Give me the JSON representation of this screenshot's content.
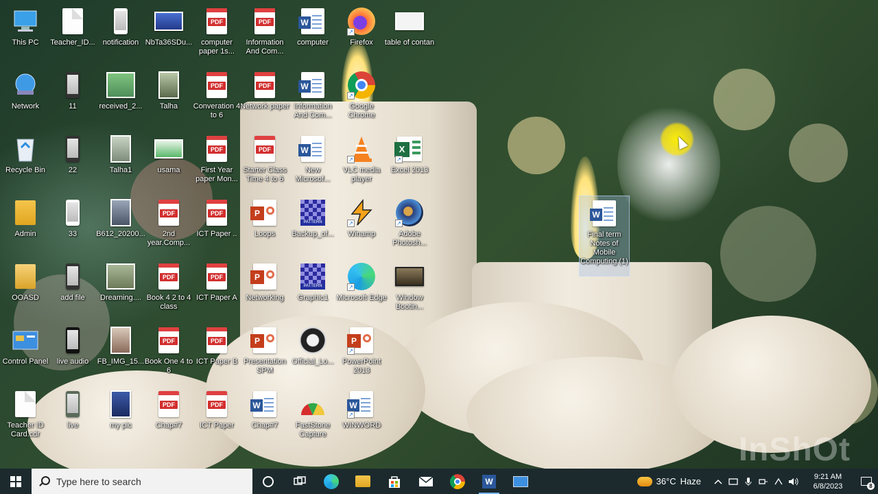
{
  "desktop": {
    "icons": {
      "this_pc": "This PC",
      "teacher_id": "Teacher_ID...",
      "notification": "notification",
      "nbta": "NbTa36SDu...",
      "computer_paper": "computer paper 1s...",
      "information_and_com_1": "Information And Com...",
      "computer": "computer",
      "firefox": "Firefox",
      "table_of_contan": "table of contan",
      "network": "Network",
      "eleven": "11",
      "received": "received_2...",
      "talha": "Talha",
      "converation": "Converation 4 to 6",
      "network_paper": "Network paper",
      "information_and_com_2": "Information And Com...",
      "google_chrome": "Google Chrome",
      "recycle_bin": "Recycle Bin",
      "twentytwo": "22",
      "talha1": "Talha1",
      "usama": "usama",
      "first_year_paper": "First Year paper Mon...",
      "starter_class": "Starter Class Time 4 to 6",
      "new_microsoft": "New Microsof...",
      "vlc": "VLC media player",
      "excel_2013": "Excel 2013",
      "admin": "Admin",
      "thirtythree": "33",
      "b612": "B612_20200...",
      "second_year": "2nd year.Comp...",
      "ict_paper_dots": "ICT Paper ..",
      "loops": "Loops",
      "backup_of": "Backup_of...",
      "winamp": "Winamp",
      "adobe_photoshop": "Adobe Photosh...",
      "final_term": "Final term Notes of Mobile Computing (1)",
      "ooasd": "OOASD",
      "add_file": "add file",
      "dreaming": "Dreaming....",
      "book_4_2": "Book 4 2 to 4 class",
      "ict_paper_a": "ICT Paper A",
      "networking": "Networking",
      "graphic1": "Graphic1",
      "microsoft_edge": "Microsoft Edge",
      "window_booting": "Window Bootin...",
      "control_panel": "Control Panel",
      "live_audio": "live audio",
      "fb_img": "FB_IMG_15...",
      "book_one": "Book One 4 to 6",
      "ict_paper_b": "ICT Paper B",
      "presentation_spm": "Presentation SPM",
      "official_lo": "Official_Lo...",
      "powerpoint_2013": "PowerPoint 2013",
      "teacher_id_card": "Teacher ID Card.cdr",
      "live": "live",
      "my_pic": "my pic",
      "chap7_pdf": "Chap#7",
      "ict_paper": "ICT Paper",
      "chap7_word": "Chap#7",
      "faststone": "FastStone Capture",
      "winword": "WINWORD"
    },
    "pdf_badge": "PDF",
    "word_badge": "W",
    "ppt_badge": "P",
    "excel_badge": "X",
    "pattern_badge": "PATTERN",
    "watermark": "InShOt"
  },
  "taskbar": {
    "search_placeholder": "Type here to search",
    "weather_temp": "36°C",
    "weather_desc": "Haze",
    "time": "9:21 AM",
    "date": "6/8/2023",
    "notification_count": "8"
  },
  "colors": {
    "taskbar_bg": "#1c2a2e",
    "search_bg": "#f2f2f2",
    "pdf_red": "#d32f2f",
    "word_blue": "#2b579a",
    "excel_green": "#1d6f42",
    "ppt_orange": "#c43e1c",
    "cursor_highlight": "#ffe600"
  }
}
